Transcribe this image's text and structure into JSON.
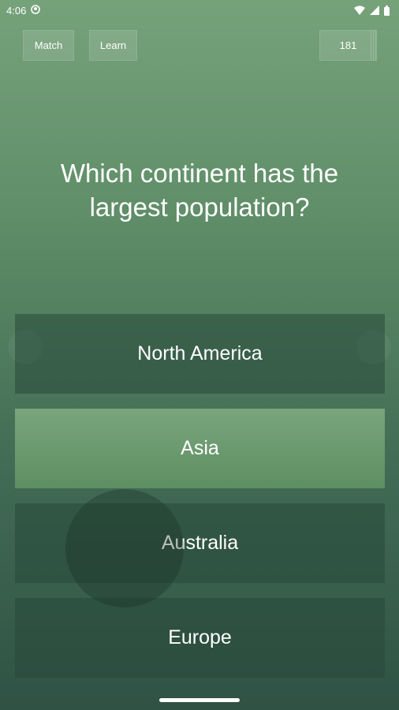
{
  "status_bar": {
    "time": "4:06",
    "icons": [
      "notification-icon",
      "wifi-icon",
      "signal-icon",
      "battery-icon"
    ]
  },
  "toolbar": {
    "match_label": "Match",
    "learn_label": "Learn",
    "score": "181"
  },
  "question": {
    "text": "Which continent has the largest population?"
  },
  "answers": [
    {
      "label": "North America",
      "selected": false
    },
    {
      "label": "Asia",
      "selected": true
    },
    {
      "label": "Australia",
      "selected": false
    },
    {
      "label": "Europe",
      "selected": false
    }
  ],
  "colors": {
    "background_top": "#76a27a",
    "background_bottom": "#2f5244",
    "selected_answer": "#6d9a70",
    "answer_default": "#28483a",
    "text": "#ffffff"
  }
}
